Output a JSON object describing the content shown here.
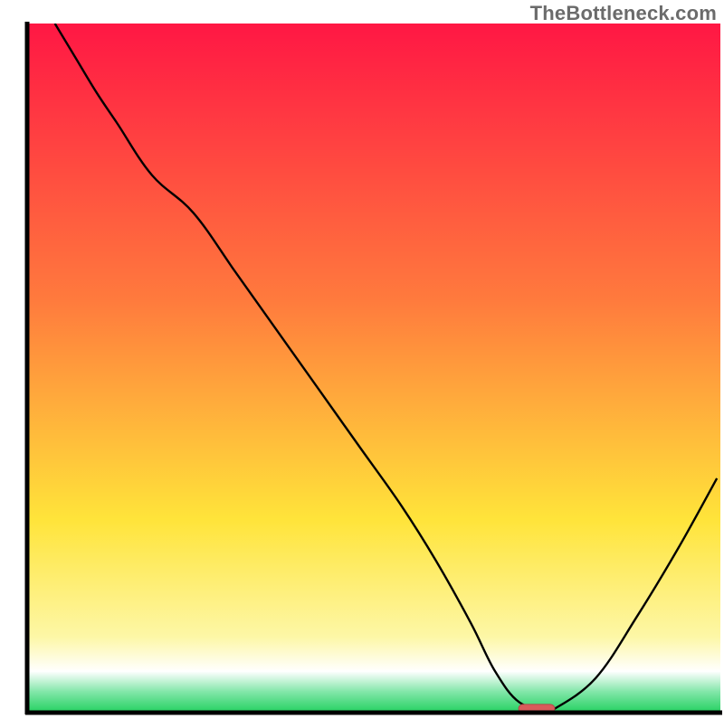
{
  "watermark": "TheBottleneck.com",
  "colors": {
    "gradient_top": "#ff1744",
    "gradient_mid_orange": "#ff7a3d",
    "gradient_mid_yellow": "#ffe43a",
    "gradient_pale_yellow": "#fdf7a6",
    "gradient_bottom_green": "#23d160",
    "curve_stroke": "#000000",
    "axes_stroke": "#000000",
    "marker_fill": "#d85b5b",
    "marker_stroke": "#b24a4a"
  },
  "chart_data": {
    "type": "line",
    "title": "",
    "xlabel": "",
    "ylabel": "",
    "xlim": [
      0,
      100
    ],
    "ylim": [
      0,
      100
    ],
    "grid": false,
    "legend": false,
    "notes": "Axes have no visible tick labels. Values are approximate, read from the geometry (0 at bottom-left, 100 at top-right).",
    "curve": {
      "x": [
        4,
        7,
        10,
        13,
        18,
        24,
        30,
        36,
        42,
        48,
        54,
        59,
        64,
        67.5,
        71,
        75,
        76,
        82,
        88,
        94,
        99.5
      ],
      "y": [
        100,
        95,
        90,
        85.5,
        78,
        72.5,
        64,
        55.5,
        47,
        38.5,
        30,
        22,
        13,
        6,
        1.5,
        0.5,
        0.5,
        5,
        14,
        24,
        34
      ]
    },
    "marker": {
      "shape": "rounded-rect",
      "x": 73.5,
      "y": 0.6,
      "width_pct": 5.2,
      "height_pct": 1.2
    },
    "background_bands_vertical_pct_from_top": [
      {
        "color": "#ff1744",
        "stop": 0
      },
      {
        "color": "#ff7a3d",
        "stop": 40
      },
      {
        "color": "#ffe43a",
        "stop": 72
      },
      {
        "color": "#fdf7a6",
        "stop": 89
      },
      {
        "color": "#ffffff",
        "stop": 94
      },
      {
        "color": "#81e6a8",
        "stop": 97
      },
      {
        "color": "#23d160",
        "stop": 100
      }
    ]
  }
}
